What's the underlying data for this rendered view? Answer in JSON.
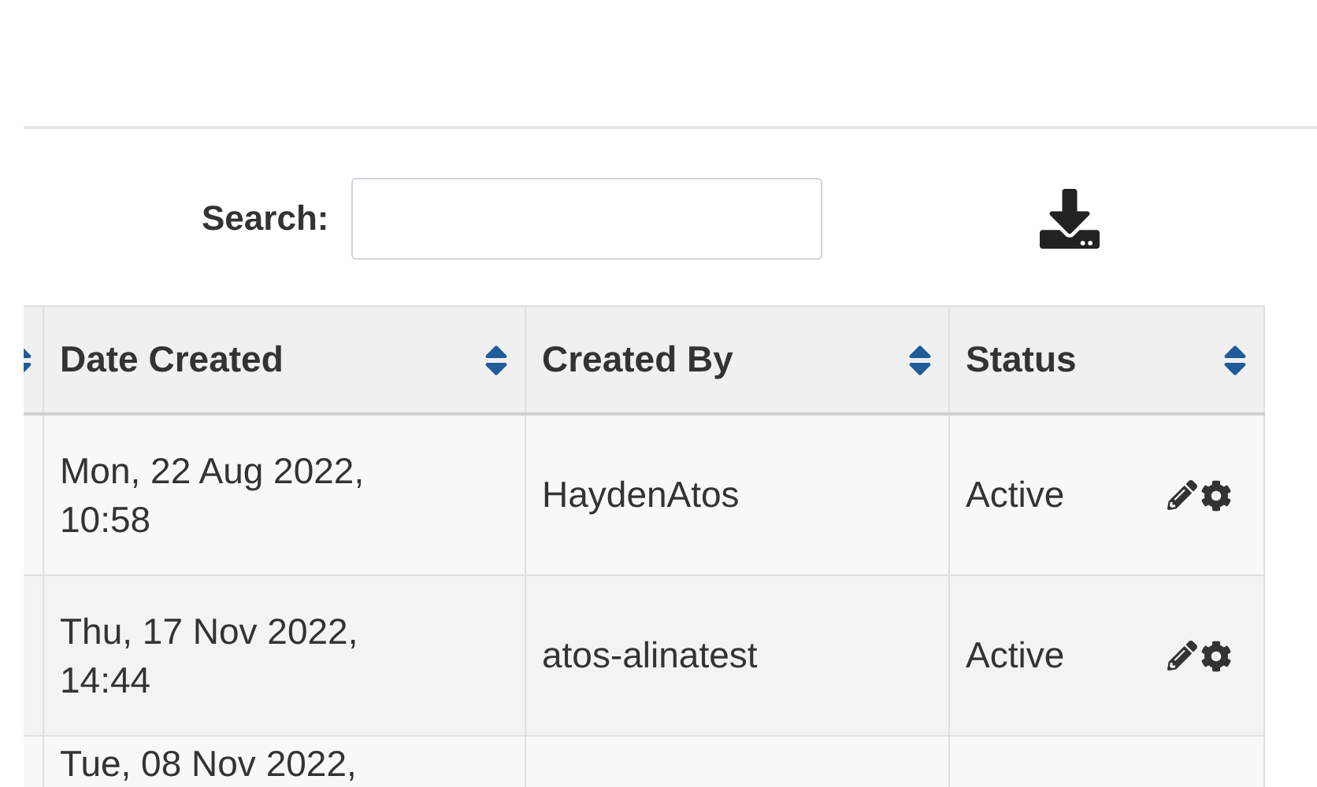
{
  "search": {
    "label": "Search:"
  },
  "table": {
    "columns": [
      {
        "label": "Date Created"
      },
      {
        "label": "Created By"
      },
      {
        "label": "Status"
      }
    ],
    "rows": [
      {
        "date": "Mon, 22 Aug 2022,",
        "time": "10:58",
        "created_by": "HaydenAtos",
        "status": "Active"
      },
      {
        "date": "Thu, 17 Nov 2022,",
        "time": "14:44",
        "created_by": "atos-alinatest",
        "status": "Active"
      },
      {
        "date": "Tue, 08 Nov 2022,"
      }
    ]
  }
}
